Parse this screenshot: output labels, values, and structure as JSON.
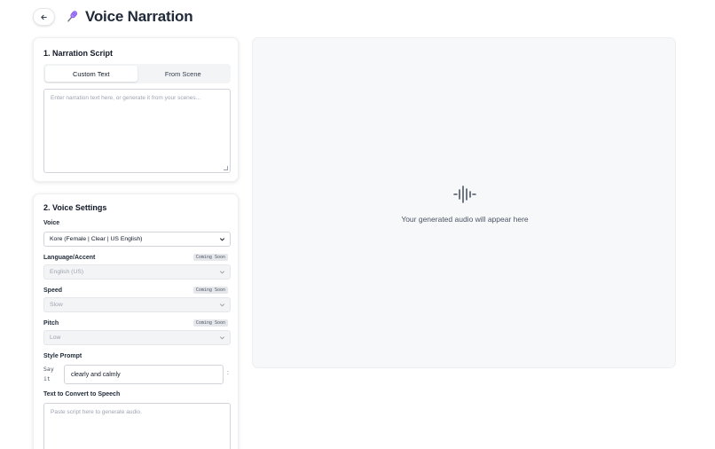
{
  "header": {
    "back_icon": "arrow-left-icon",
    "mic_icon": "microphone-icon",
    "title": "Voice Narration"
  },
  "script_card": {
    "title": "1. Narration Script",
    "tabs": [
      {
        "label": "Custom Text",
        "active": true
      },
      {
        "label": "From Scene",
        "active": false
      }
    ],
    "textarea_placeholder": "Enter narration text here, or generate it from your scenes..."
  },
  "voice_card": {
    "title": "2. Voice Settings",
    "voice": {
      "label": "Voice",
      "value": "Kore (Female | Clear | US English)"
    },
    "language": {
      "label": "Language/Accent",
      "badge": "Coming Soon",
      "value": "English (US)"
    },
    "speed": {
      "label": "Speed",
      "badge": "Coming Soon",
      "value": "Slow"
    },
    "pitch": {
      "label": "Pitch",
      "badge": "Coming Soon",
      "value": "Low"
    },
    "style_prompt": {
      "label": "Style Prompt",
      "prefix": "Say it",
      "value": "clearly and calmly",
      "suffix": ":"
    },
    "tts": {
      "label": "Text to Convert to Speech",
      "placeholder": "Paste script here to generate audio."
    }
  },
  "output_panel": {
    "icon": "audio-waveform-icon",
    "empty_text": "Your generated audio will appear here"
  },
  "colors": {
    "accent_mic": "#a855f7",
    "text_primary": "#111827",
    "panel_bg": "#f7f8fa"
  }
}
